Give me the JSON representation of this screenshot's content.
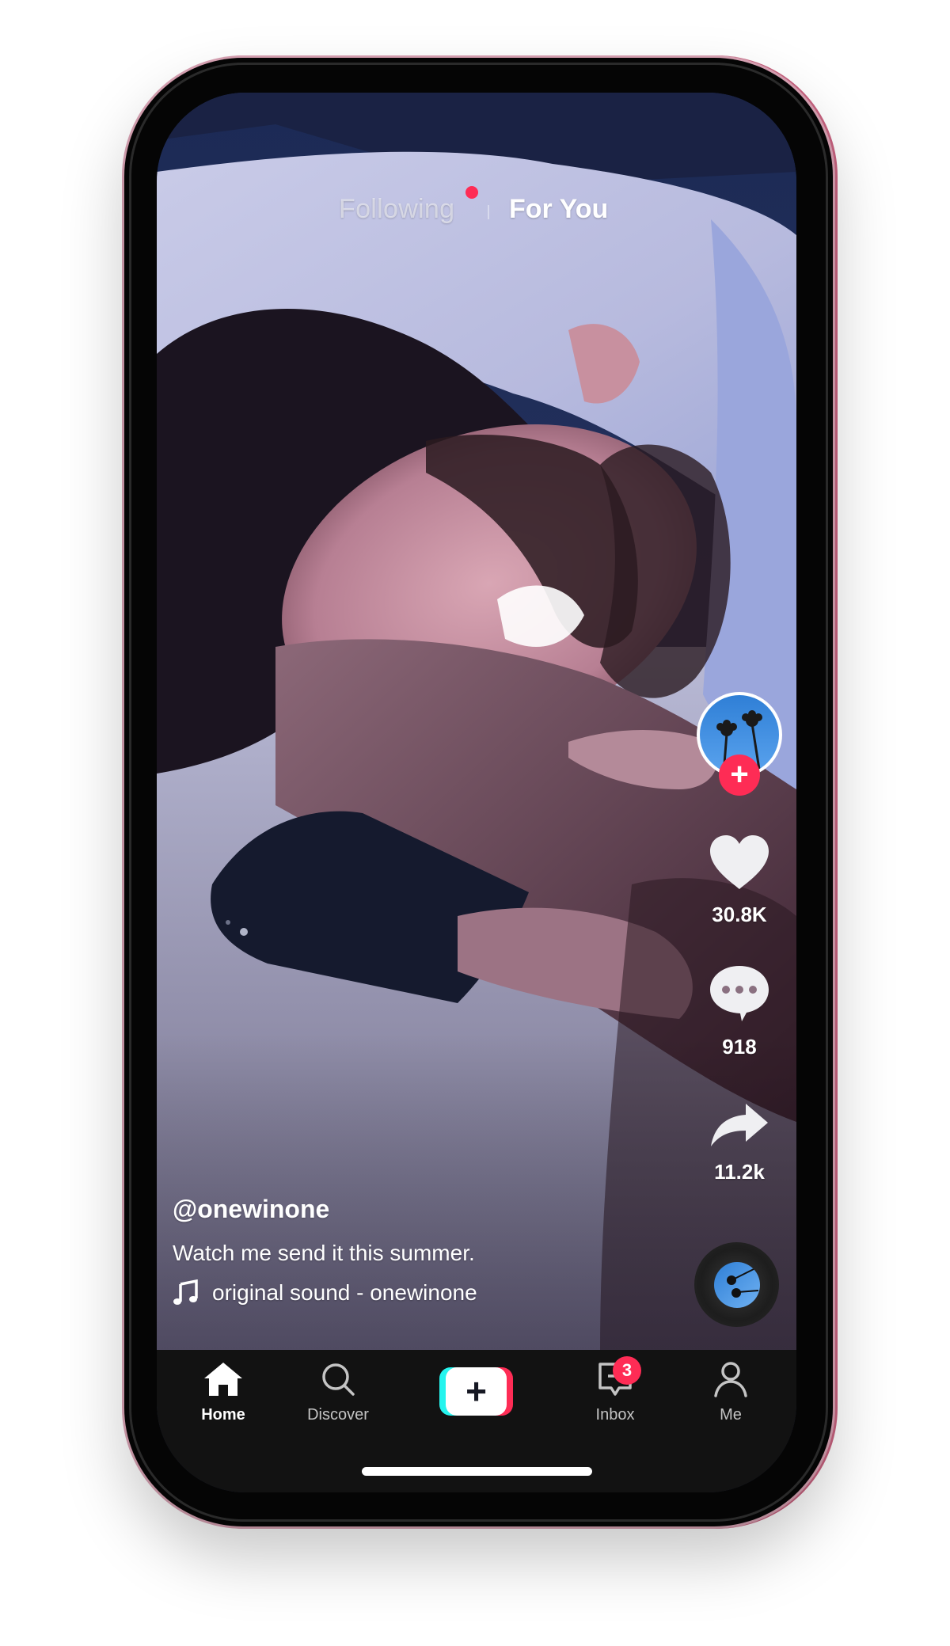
{
  "app": "TikTok",
  "top_tabs": {
    "following": "Following",
    "for_you": "For You",
    "active": "For You",
    "following_has_new": true
  },
  "creator": {
    "avatar_icon": "palm-trees-avatar",
    "follow_icon": "plus-icon",
    "follow_symbol": "+"
  },
  "actions": {
    "likes": "30.8K",
    "comments": "918",
    "shares": "11.2k"
  },
  "post": {
    "username": "@onewinone",
    "caption": "Watch me send it this summer.",
    "sound": "original sound - onewinone"
  },
  "nav": {
    "items": [
      {
        "label": "Home",
        "icon": "home-icon",
        "active": true
      },
      {
        "label": "Discover",
        "icon": "search-icon",
        "active": false
      },
      {
        "label": "",
        "icon": "create-plus-icon",
        "active": false
      },
      {
        "label": "Inbox",
        "icon": "inbox-icon",
        "active": false,
        "badge": "3"
      },
      {
        "label": "Me",
        "icon": "profile-icon",
        "active": false
      }
    ],
    "create_symbol": "+"
  },
  "colors": {
    "accent_red": "#fe2c55",
    "accent_cyan": "#25f4ee",
    "nav_bg": "#121212"
  }
}
